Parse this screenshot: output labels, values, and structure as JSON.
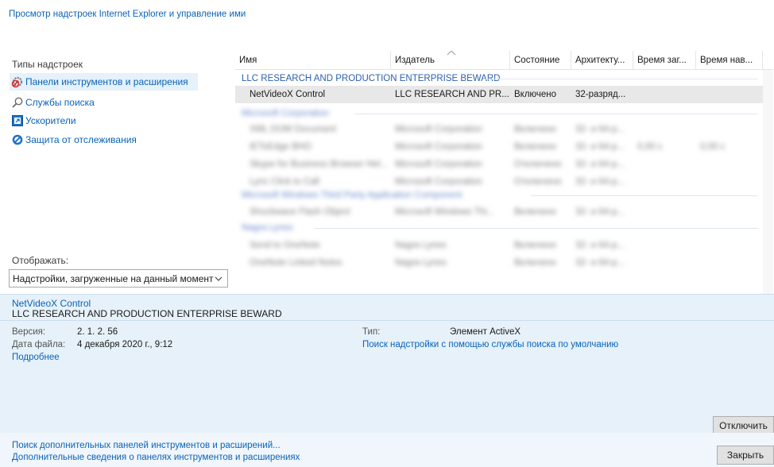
{
  "header": {
    "title": "Просмотр надстроек Internet Explorer и управление ими"
  },
  "left": {
    "types_label": "Типы надстроек",
    "types": [
      {
        "label": "Панели инструментов и расширения",
        "icon": "gear-blocked-icon"
      },
      {
        "label": "Службы поиска",
        "icon": "search-icon"
      },
      {
        "label": "Ускорители",
        "icon": "accelerator-icon"
      },
      {
        "label": "Защита от отслеживания",
        "icon": "blocked-icon"
      }
    ],
    "show_label": "Отображать:",
    "show_value": "Надстройки, загруженные на данный момент"
  },
  "list": {
    "columns": [
      "Имя",
      "Издатель",
      "Состояние",
      "Архитекту...",
      "Время заг...",
      "Время нав..."
    ],
    "groups": [
      {
        "name": "LLC RESEARCH AND PRODUCTION ENTERPRISE BEWARD",
        "rows": [
          {
            "name": "NetVideoX Control",
            "publisher": "LLC RESEARCH AND PR...",
            "status": "Включено",
            "arch": "32-разряд...",
            "load": "",
            "nav": ""
          }
        ]
      },
      {
        "name": "Microsoft Corporation",
        "rows": [
          {
            "name": "XML DOM Document",
            "publisher": "Microsoft Corporation",
            "status": "Включено",
            "arch": "32- и 64-р...",
            "load": "",
            "nav": ""
          },
          {
            "name": "IEToEdge BHO",
            "publisher": "Microsoft Corporation",
            "status": "Включено",
            "arch": "32- и 64-р...",
            "load": "0,00 с",
            "nav": "0,00 с"
          },
          {
            "name": "Skype for Business Browser Hel...",
            "publisher": "Microsoft Corporation",
            "status": "Отключено",
            "arch": "32- и 64-р...",
            "load": "",
            "nav": ""
          },
          {
            "name": "Lync Click to Call",
            "publisher": "Microsoft Corporation",
            "status": "Отключено",
            "arch": "32- и 64-р...",
            "load": "",
            "nav": ""
          }
        ]
      },
      {
        "name": "Microsoft Windows Third Party Application Component",
        "rows": [
          {
            "name": "Shockwave Flash Object",
            "publisher": "Microsoft Windows Thi...",
            "status": "Включено",
            "arch": "32- и 64-р...",
            "load": "",
            "nav": ""
          }
        ]
      },
      {
        "name": "Nagra Lynes",
        "rows": [
          {
            "name": "Send to OneNote",
            "publisher": "Nagra Lynes",
            "status": "Включено",
            "arch": "32- и 64-р...",
            "load": "",
            "nav": ""
          },
          {
            "name": "OneNote Linked Notes",
            "publisher": "Nagra Lynes",
            "status": "Включено",
            "arch": "32- и 64-р...",
            "load": "",
            "nav": ""
          }
        ]
      }
    ]
  },
  "details": {
    "name": "NetVideoX Control",
    "publisher": "LLC RESEARCH AND PRODUCTION ENTERPRISE BEWARD",
    "version_label": "Версия:",
    "version_value": "2. 1. 2. 56",
    "date_label": "Дата файла:",
    "date_value": "4 декабря 2020 г., 9:12",
    "more_link": "Подробнее",
    "type_label": "Тип:",
    "type_value": "Элемент ActiveX",
    "search_link": "Поиск надстройки с помощью службы поиска по умолчанию",
    "disable_button": "Отключить"
  },
  "footer": {
    "link1": "Поиск дополнительных панелей инструментов и расширений...",
    "link2": "Дополнительные сведения о панелях инструментов и расширениях",
    "close_button": "Закрыть"
  },
  "colors": {
    "accent": "#0a63b8",
    "details_bg": "#e6f1f9",
    "selected_row": "#e8e8e8"
  }
}
